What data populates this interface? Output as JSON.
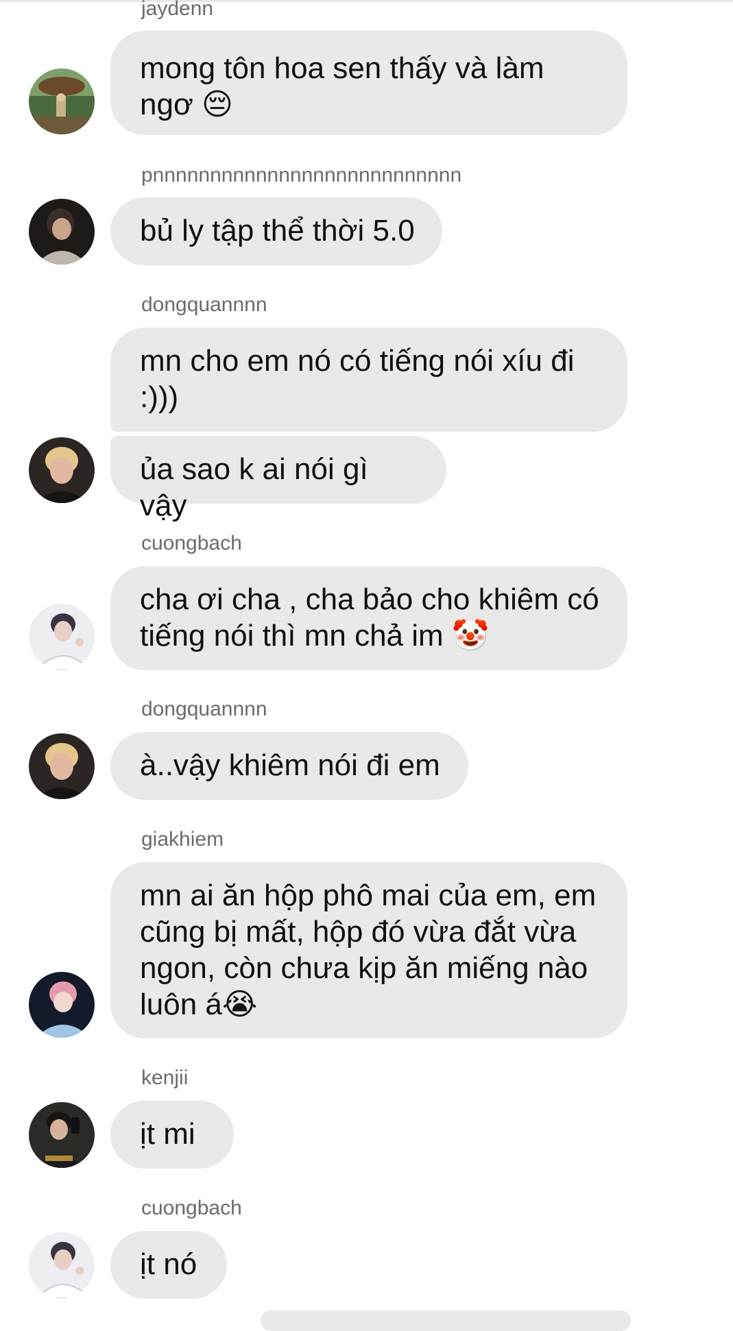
{
  "messages": [
    {
      "sender": "jaydenn",
      "text": "mong tôn hoa sen thấy và làm ngơ 😔"
    },
    {
      "sender": "pnnnnnnnnnnnnnnnnnnnnnnnnnnn",
      "text": "bủ ly tập thể thời 5.0"
    },
    {
      "sender": "dongquannnn",
      "text": "mn cho em nó có tiếng nói xíu đi :)))",
      "text2": "ủa sao k ai nói gì vậy"
    },
    {
      "sender": "cuongbach",
      "text": "cha ơi cha , cha bảo cho khiêm có tiếng nói thì mn chả im 🤡"
    },
    {
      "sender": "dongquannnn",
      "text": "à..vậy khiêm nói đi em"
    },
    {
      "sender": "giakhiem",
      "text": "mn ai ăn hộp phô mai của em, em cũng bị mất, hộp đó vừa đắt vừa ngon, còn chưa kịp ăn miếng nào luôn á😭"
    },
    {
      "sender": "kenjii",
      "text": "ịt mi"
    },
    {
      "sender": "cuongbach",
      "text": "ịt nó"
    }
  ],
  "avatars": {
    "jaydenn": "avatar-photo-outdoor",
    "pnnnnnnnnnnnnnnnnnnnnnnnnnnn": "avatar-photo-dark",
    "dongquannnn": "avatar-photo-blonde",
    "cuongbach": "avatar-photo-white-suit",
    "giakhiem": "avatar-photo-pink-hair",
    "kenjii": "avatar-photo-mirror-selfie"
  }
}
